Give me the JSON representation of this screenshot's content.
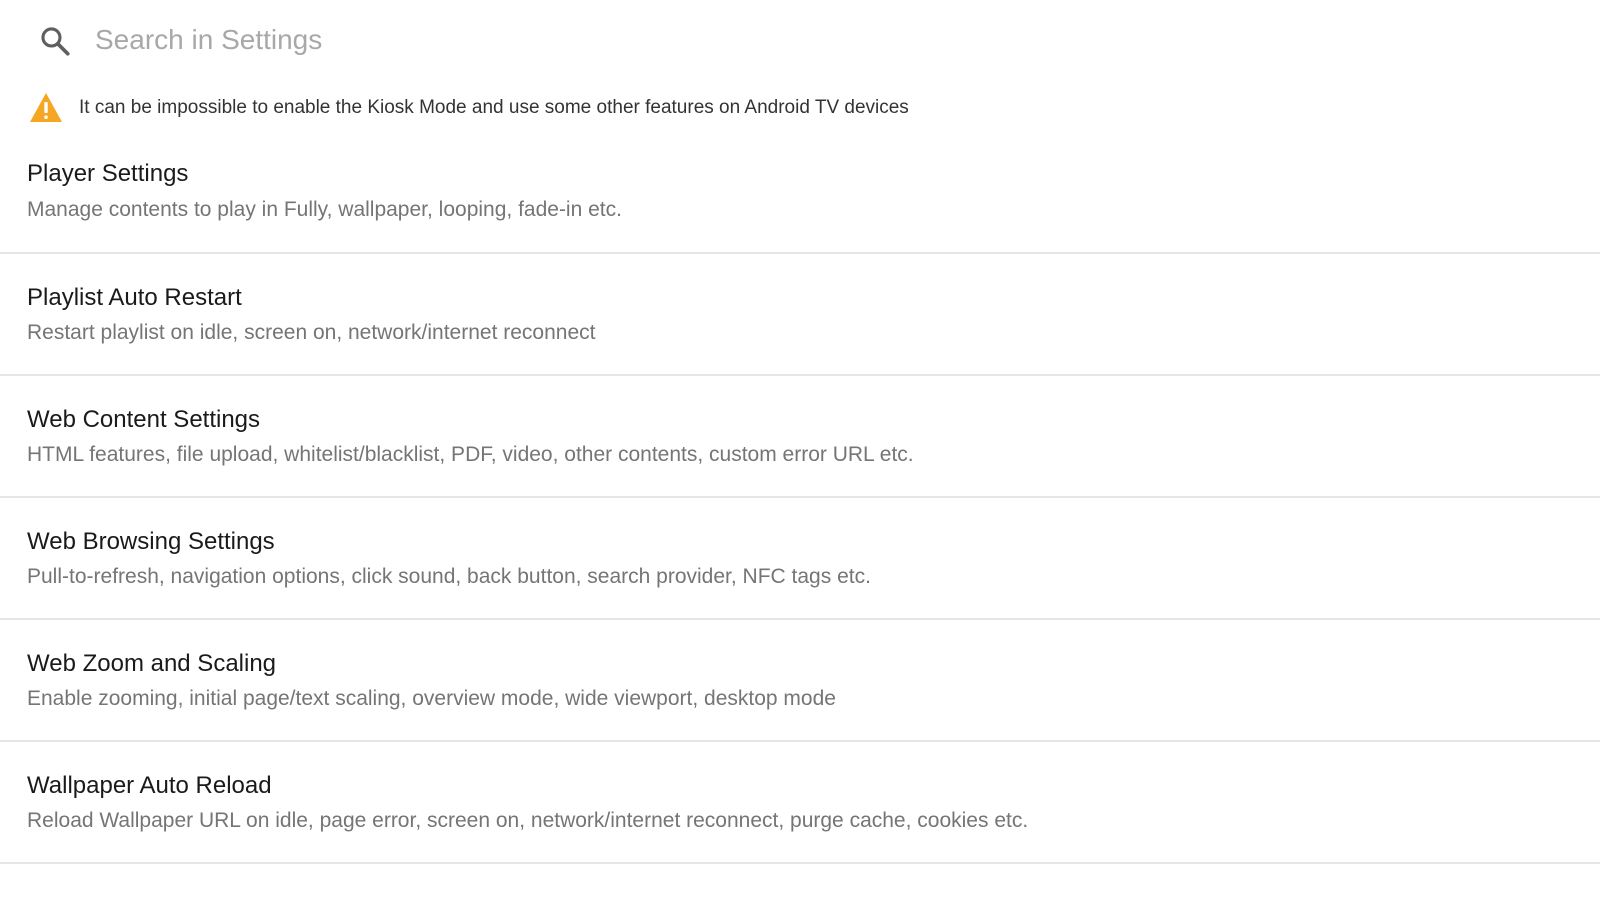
{
  "search": {
    "placeholder": "Search in Settings",
    "value": "",
    "icon": "search-icon"
  },
  "warning": {
    "icon": "warning-triangle-icon",
    "color": "#f5a623",
    "text": "It can be impossible to enable the Kiosk Mode and use some other features on Android TV devices"
  },
  "settings": [
    {
      "title": "Player Settings",
      "summary": "Manage contents to play in Fully, wallpaper, looping, fade-in etc."
    },
    {
      "title": "Playlist Auto Restart",
      "summary": "Restart playlist on idle, screen on, network/internet reconnect"
    },
    {
      "title": "Web Content Settings",
      "summary": "HTML features, file upload, whitelist/blacklist, PDF, video, other contents, custom error URL etc."
    },
    {
      "title": "Web Browsing Settings",
      "summary": "Pull-to-refresh, navigation options, click sound, back button, search provider, NFC tags etc."
    },
    {
      "title": "Web Zoom and Scaling",
      "summary": "Enable zooming, initial page/text scaling, overview mode, wide viewport, desktop mode"
    },
    {
      "title": "Wallpaper Auto Reload",
      "summary": "Reload Wallpaper URL on idle, page error, screen on, network/internet reconnect, purge cache, cookies etc."
    }
  ]
}
